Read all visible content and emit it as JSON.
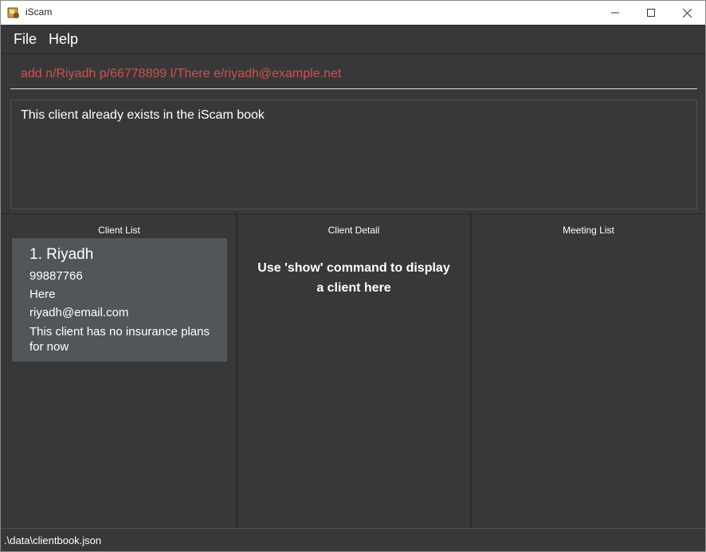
{
  "window": {
    "title": "iScam",
    "icon": "iscam-app-icon"
  },
  "menu": {
    "file": "File",
    "help": "Help"
  },
  "command": {
    "value": "add n/Riyadh p/66778899 l/There e/riyadh@example.net",
    "color": "#d05050"
  },
  "result": {
    "message": "This client already exists in the iScam book"
  },
  "panels": {
    "client_list": {
      "title": "Client List",
      "clients": [
        {
          "index": "1.",
          "name": "Riyadh",
          "phone": "99887766",
          "location": "Here",
          "email": "riyadh@email.com",
          "plans": "This client has no insurance plans for now"
        }
      ]
    },
    "client_detail": {
      "title": "Client Detail",
      "message": "Use 'show' command to display a client here"
    },
    "meeting_list": {
      "title": "Meeting List"
    }
  },
  "status": {
    "path": ".\\data\\clientbook.json"
  },
  "colors": {
    "background": "#383838",
    "card": "#515658",
    "error_text": "#d05050"
  }
}
